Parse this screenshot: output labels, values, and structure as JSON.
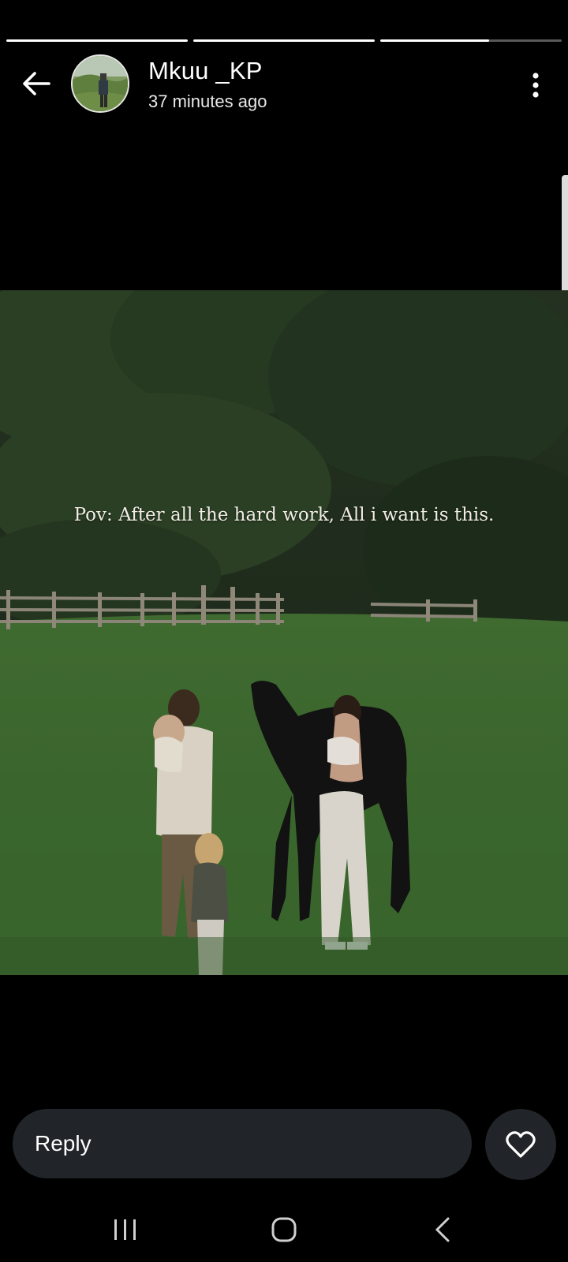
{
  "story": {
    "progress_segments": [
      1.0,
      1.0,
      0.6
    ],
    "author": {
      "username": "Mkuu _KP",
      "posted": "37 minutes ago"
    },
    "caption": "Pov: After all the hard work, All i want is this."
  },
  "icons": {
    "back": "back-arrow-icon",
    "menu": "more-vertical-icon",
    "like": "heart-icon"
  },
  "reply": {
    "label": "Reply"
  },
  "navbar": {
    "buttons": [
      "recent-apps",
      "home",
      "back"
    ]
  }
}
